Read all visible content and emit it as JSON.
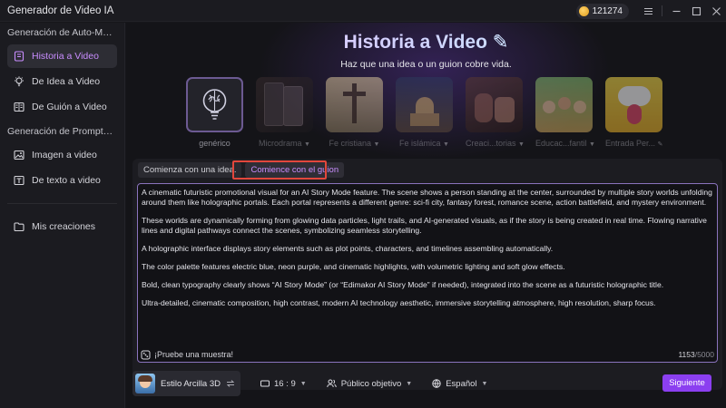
{
  "window": {
    "title": "Generador de Video IA",
    "credits": "121274"
  },
  "sidebar": {
    "section1": "Generación de Auto-Match d...",
    "section2": "Generación de Prompts de IA",
    "items": [
      {
        "label": "Historia a Video",
        "icon": "story-icon"
      },
      {
        "label": "De Idea a Video",
        "icon": "bulb-icon"
      },
      {
        "label": "De Guión a Video",
        "icon": "script-icon"
      },
      {
        "label": "Imagen a video",
        "icon": "image-icon"
      },
      {
        "label": "De texto a video",
        "icon": "text-icon"
      },
      {
        "label": "Mis creaciones",
        "icon": "folder-icon"
      }
    ]
  },
  "hero": {
    "title": "Historia a Video",
    "subtitle": "Haz que una idea o un guion cobre vida."
  },
  "cards": [
    {
      "label": "genérico"
    },
    {
      "label": "Microdrama"
    },
    {
      "label": "Fe cristiana"
    },
    {
      "label": "Fe islámica"
    },
    {
      "label": "Creaci...torias"
    },
    {
      "label": "Educac...fantil"
    },
    {
      "label": "Entrada Per..."
    }
  ],
  "tabs": {
    "idea": "Comienza con una idea.",
    "script": "Comience con el guion"
  },
  "editor": {
    "paragraphs": [
      "A cinematic futuristic promotional visual for an AI Story Mode feature. The scene shows a person standing at the center, surrounded by multiple story worlds unfolding around them like holographic portals. Each portal represents a different genre: sci-fi city, fantasy forest, romance scene, action battlefield, and mystery environment.",
      "These worlds are dynamically forming from glowing data particles, light trails, and AI-generated visuals, as if the story is being created in real time. Flowing narrative lines and digital pathways connect the scenes, symbolizing seamless storytelling.",
      "A holographic interface displays story elements such as plot points, characters, and timelines assembling automatically.",
      "The color palette features electric blue, neon purple, and cinematic highlights, with volumetric lighting and soft glow effects.",
      "Bold, clean typography clearly shows “AI Story Mode” (or “Edimakor AI Story Mode” if needed), integrated into the scene as a futuristic holographic title.",
      "Ultra-detailed, cinematic composition, high contrast, modern AI technology aesthetic, immersive storytelling atmosphere, high resolution, sharp focus."
    ],
    "sample_label": "¡Pruebe una muestra!",
    "count": "1153",
    "max": "/5000"
  },
  "bottom": {
    "style": "Estilo Arcilla 3D",
    "ratio": "16 : 9",
    "audience": "Público objetivo",
    "language": "Español",
    "next": "Siguiente"
  },
  "colors": {
    "accent": "#8b3ff0",
    "active_text": "#c98dff",
    "highlight_border": "#e2473c"
  }
}
